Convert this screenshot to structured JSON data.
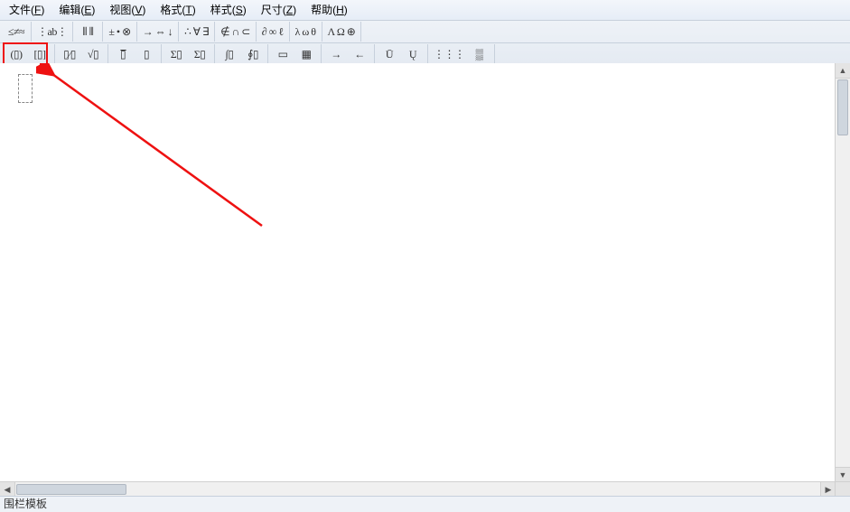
{
  "menu": {
    "file": {
      "pre": "文件(",
      "key": "F",
      "post": ")"
    },
    "edit": {
      "pre": "编辑(",
      "key": "E",
      "post": ")"
    },
    "view": {
      "pre": "视图(",
      "key": "V",
      "post": ")"
    },
    "format": {
      "pre": "格式(",
      "key": "T",
      "post": ")"
    },
    "style": {
      "pre": "样式(",
      "key": "S",
      "post": ")"
    },
    "size": {
      "pre": "尺寸(",
      "key": "Z",
      "post": ")"
    },
    "help": {
      "pre": "帮助(",
      "key": "H",
      "post": ")"
    }
  },
  "tb1": {
    "g1": {
      "a": "≤≠≈"
    },
    "g2": {
      "a": "⋮ab⋮"
    },
    "g3": {
      "a": "⦀ ⦀"
    },
    "g4": {
      "a": "± • ⊗"
    },
    "g5": {
      "a": "→ ⇔ ↓"
    },
    "g6": {
      "a": "∴ ∀ ∃"
    },
    "g7": {
      "a": "∉ ∩ ⊂"
    },
    "g8": {
      "a": "∂ ∞ ℓ"
    },
    "g9": {
      "a": "λ ω θ"
    },
    "g10": {
      "a": "Λ Ω ⊕"
    }
  },
  "tb2": {
    "g1": {
      "a": "(▯)",
      "b": "[▯]"
    },
    "g2": {
      "a": "▯⁄▯",
      "b": "√▯"
    },
    "g3": {
      "a": "▯̅",
      "b": "▯"
    },
    "g4": {
      "a": "Σ▯",
      "b": "Σ▯"
    },
    "g5": {
      "a": "∫▯",
      "b": "∮▯"
    },
    "g6": {
      "a": "▭",
      "b": "▦"
    },
    "g7": {
      "a": "→",
      "b": "←"
    },
    "g8": {
      "a": "Ū",
      "b": "Ų"
    },
    "g9": {
      "a": "⋮⋮⋮",
      "b": "▒"
    }
  },
  "status": {
    "text": "围栏模板"
  }
}
